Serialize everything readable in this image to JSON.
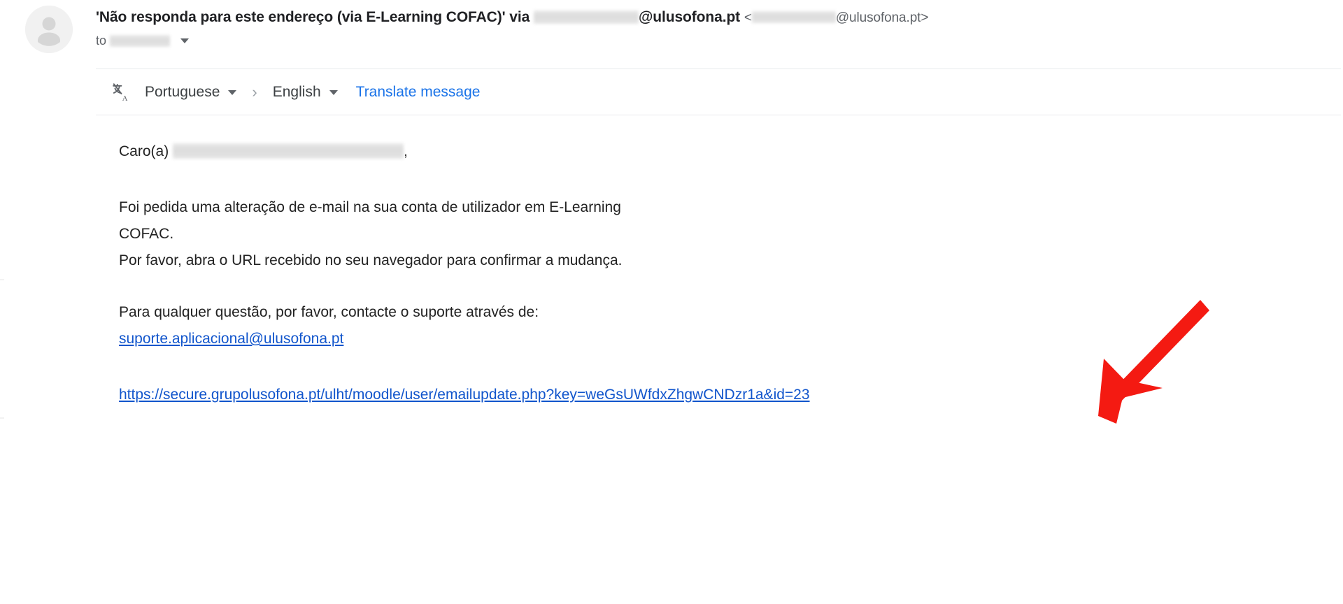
{
  "header": {
    "avatar_alt": "generic contact avatar",
    "subject_prefix": "'Não responda para este endereço (via E-Learning COFAC)' via ",
    "sender_domain": "@ulusofona.pt",
    "angle_open": "<",
    "angle_close": "@ulusofona.pt>",
    "to_label": "to",
    "to_caret": "▾"
  },
  "translate_bar": {
    "icon": "translate-icon",
    "icon_glyph": "文A",
    "source_language": "Portuguese",
    "arrow": "›",
    "target_language": "English",
    "translate_action": "Translate message"
  },
  "message": {
    "greeting_prefix": "Caro(a)",
    "greeting_suffix": ",",
    "paragraph_1_line_1": "Foi pedida uma alteração de e-mail na sua conta de utilizador em E-Learning",
    "paragraph_1_line_2": "COFAC.",
    "paragraph_2": "Por favor, abra o URL recebido no seu navegador para confirmar a mudança.",
    "paragraph_3": "Para qualquer questão, por favor, contacte o suporte através de:",
    "support_email": "suporte.aplicacional@ulusofona.pt",
    "confirmation_url": "https://secure.grupolusofona.pt/ulht/moodle/user/emailupdate.php?key=weGsUWfdxZhgwCNDzr1a&id=23"
  },
  "annotation": {
    "type": "arrow",
    "color": "#f41a12",
    "direction": "down-left",
    "points_to": "confirmation-url-link"
  },
  "colors": {
    "link_blue": "#1155cc",
    "action_blue": "#1a73e8",
    "body_text": "#222222",
    "muted_text": "#5f6368",
    "divider": "#e8eaed",
    "annotation_red": "#f41a12"
  }
}
